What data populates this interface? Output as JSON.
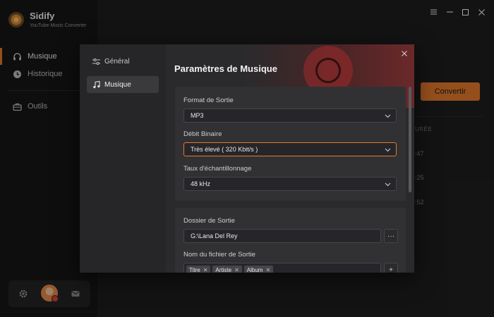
{
  "app": {
    "name": "Sidify",
    "subtitle": "YouTube Music Converter"
  },
  "sidebar": {
    "items": [
      {
        "label": "Musique",
        "icon": "headphones-icon",
        "active": true
      },
      {
        "label": "Historique",
        "icon": "clock-icon",
        "active": false
      },
      {
        "label": "Outils",
        "icon": "toolbox-icon",
        "active": false
      }
    ]
  },
  "bottom": {
    "icons": [
      "gear-icon",
      "mail-icon"
    ]
  },
  "background": {
    "convert_label": "Convertir",
    "col_head": "URÉE",
    "times": [
      ":47",
      ":25",
      ":52"
    ]
  },
  "dialog": {
    "side_items": [
      {
        "label": "Général",
        "icon": "sliders-icon",
        "active": false
      },
      {
        "label": "Musique",
        "icon": "music-note-icon",
        "active": true
      }
    ],
    "title": "Paramètres de Musique",
    "format": {
      "label": "Format de Sortie",
      "value": "MP3"
    },
    "bitrate": {
      "label": "Débit Binaire",
      "value": "Très élevé ( 320 Kbit/s )"
    },
    "samplerate": {
      "label": "Taux d'échantillonnage",
      "value": "48 kHz"
    },
    "folder": {
      "label": "Dossier de Sortie",
      "value": "G:\\Lana Del Rey",
      "browse": "···"
    },
    "filename": {
      "label": "Nom du fichier de Sortie",
      "tags": [
        "Titre",
        "Artiste",
        "Album"
      ],
      "add": "+"
    }
  },
  "colors": {
    "accent": "#e57a2c"
  }
}
